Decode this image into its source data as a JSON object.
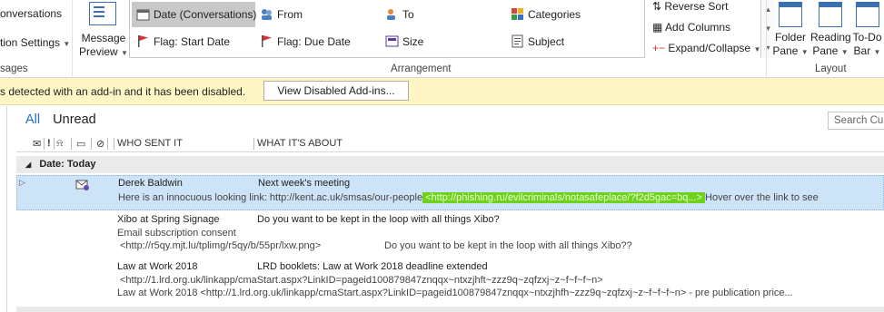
{
  "ribbon": {
    "left": {
      "item1": "onversations",
      "item2": "tion Settings",
      "label": "sages"
    },
    "message_preview": "Message Preview",
    "gallery": {
      "row1": [
        "Date (Conversations)",
        "From",
        "To",
        "Categories"
      ],
      "row2": [
        "Flag: Start Date",
        "Flag: Due Date",
        "Size",
        "Subject"
      ]
    },
    "arrangement_label": "Arrangement",
    "sort": {
      "reverse": "Reverse Sort",
      "add_columns": "Add Columns",
      "expand": "Expand/Collapse"
    },
    "layout": {
      "folder_pane": [
        "Folder",
        "Pane"
      ],
      "reading_pane": [
        "Reading",
        "Pane"
      ],
      "todo_bar": [
        "To-Do",
        "Bar"
      ],
      "label": "Layout"
    }
  },
  "infobar": {
    "message": "s detected with an add-in and it has been disabled.",
    "button": "View Disabled Add-ins..."
  },
  "filters": {
    "all": "All",
    "unread": "Unread"
  },
  "search": {
    "placeholder": "Search Curr"
  },
  "columns": {
    "who": "WHO SENT IT",
    "what": "WHAT IT'S ABOUT"
  },
  "group": {
    "label": "Date: Today"
  },
  "messages": [
    {
      "sender": "Derek Baldwin",
      "subject": "Next week's meeting",
      "preview_start": "Here is an innocuous looking link: http://kent.ac.uk/smsas/our-people",
      "preview_link": " <http://phishing.ru/evilcriminals/notasafeplace/?f2d5gac=bq...> ",
      "preview_end": "   Hover over the link to see"
    },
    {
      "sender": "Xibo at Spring Signage",
      "subject": "Do you want to be kept in the loop with all things Xibo?",
      "line2": "Email subscription consent",
      "line3a": "<http://r5qy.mjt.lu/tplimg/r5qy/b/55pr/lxw.png>",
      "line3b": "Do you want to be kept in the loop with all things Xibo??"
    },
    {
      "sender": "Law at Work 2018",
      "subject": "LRD booklets: Law at Work 2018  deadline extended",
      "line2": "<http://1.lrd.org.uk/linkapp/cmaStart.aspx?LinkID=pageid100879847znqqx~ntxzjhft~zzz9q~zqfzxj~z~f~f~f~n>",
      "line3": "Law at Work 2018 <http://1.lrd.org.uk/linkapp/cmaStart.aspx?LinkID=pageid100879847znqqx~ntxzjhfh~zzz9q~zqfzxj~z~f~f~f~n>  - pre publication price..."
    }
  ]
}
